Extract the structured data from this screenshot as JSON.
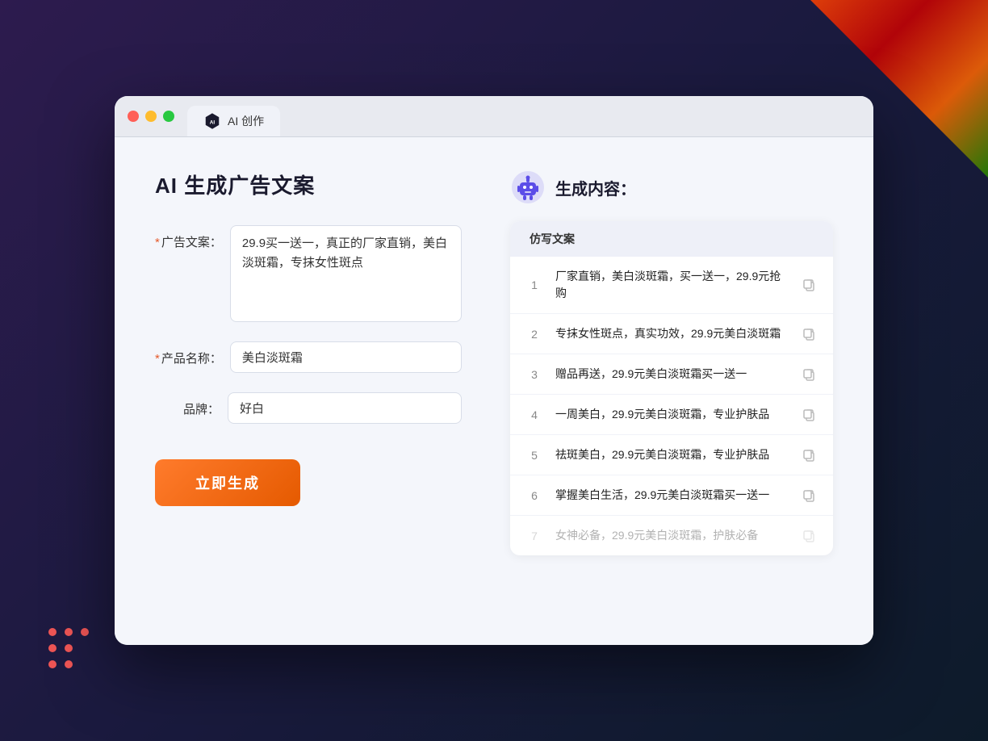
{
  "browser": {
    "tab_title": "AI 创作",
    "traffic_lights": [
      "red",
      "yellow",
      "green"
    ]
  },
  "page": {
    "title": "AI 生成广告文案",
    "form": {
      "ad_copy_label": "广告文案：",
      "ad_copy_required": true,
      "ad_copy_value": "29.9买一送一，真正的厂家直销，美白淡斑霜，专抹女性斑点",
      "product_name_label": "产品名称：",
      "product_name_required": true,
      "product_name_value": "美白淡斑霜",
      "brand_label": "品牌：",
      "brand_required": false,
      "brand_value": "好白",
      "generate_button": "立即生成"
    },
    "result": {
      "header_title": "生成内容：",
      "table_header": "仿写文案",
      "rows": [
        {
          "num": 1,
          "text": "厂家直销，美白淡斑霜，买一送一，29.9元抢购",
          "faded": false
        },
        {
          "num": 2,
          "text": "专抹女性斑点，真实功效，29.9元美白淡斑霜",
          "faded": false
        },
        {
          "num": 3,
          "text": "赠品再送，29.9元美白淡斑霜买一送一",
          "faded": false
        },
        {
          "num": 4,
          "text": "一周美白，29.9元美白淡斑霜，专业护肤品",
          "faded": false
        },
        {
          "num": 5,
          "text": "祛斑美白，29.9元美白淡斑霜，专业护肤品",
          "faded": false
        },
        {
          "num": 6,
          "text": "掌握美白生活，29.9元美白淡斑霜买一送一",
          "faded": false
        },
        {
          "num": 7,
          "text": "女神必备，29.9元美白淡斑霜，护肤必备",
          "faded": true
        }
      ]
    }
  }
}
